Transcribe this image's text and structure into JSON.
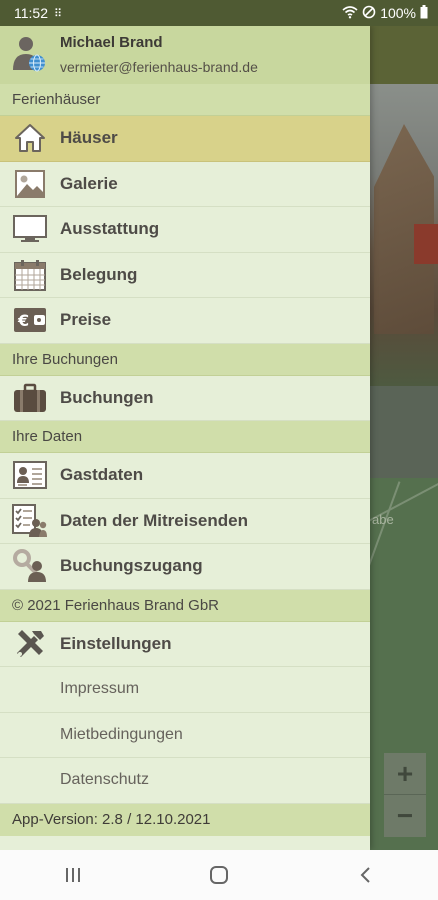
{
  "status_bar": {
    "time": "11:52",
    "battery": "100%"
  },
  "user": {
    "name": "Michael Brand",
    "email": "vermieter@ferienhaus-brand.de"
  },
  "sections": {
    "houses": "Ferienhäuser",
    "bookings": "Ihre Buchungen",
    "data": "Ihre Daten",
    "copyright": "© 2021 Ferienhaus Brand GbR"
  },
  "menu": {
    "haeuser": "Häuser",
    "galerie": "Galerie",
    "ausstattung": "Ausstattung",
    "belegung": "Belegung",
    "preise": "Preise",
    "buchungen": "Buchungen",
    "gastdaten": "Gastdaten",
    "mitreisende": "Daten der Mitreisenden",
    "buchungszugang": "Buchungszugang",
    "einstellungen": "Einstellungen",
    "impressum": "Impressum",
    "mietbedingungen": "Mietbedingungen",
    "datenschutz": "Datenschutz"
  },
  "footer": {
    "version": "App-Version: 2.8 / 12.10.2021"
  },
  "background": {
    "partial_text": "g",
    "map_label": "abe",
    "zoom_in": "+",
    "zoom_out": "−"
  },
  "colors": {
    "drawer_bg": "#e6efd8",
    "section_bg": "#d0deaa",
    "active_bg": "#d8d28a",
    "status_bar": "#4f5a33"
  }
}
